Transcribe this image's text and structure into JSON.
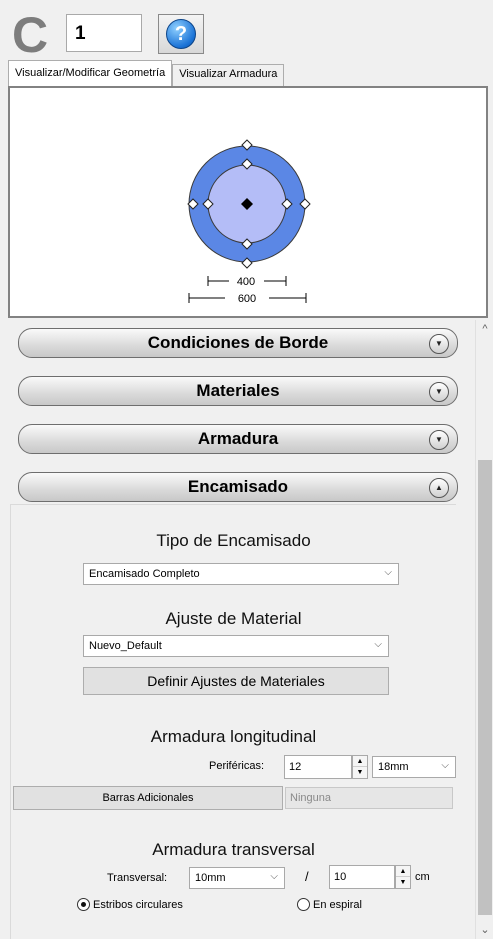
{
  "header": {
    "type_letter": "C",
    "element_id": "1",
    "help_icon": "question-icon"
  },
  "tabs": [
    {
      "label": "Visualizar/Modificar Geometría",
      "active": true
    },
    {
      "label": "Visualizar Armadura",
      "active": false
    }
  ],
  "geometry": {
    "inner_dim_label": "400",
    "outer_dim_label": "600",
    "outer_color": "#5b87e5",
    "inner_color": "#b4bdf7"
  },
  "sections": [
    {
      "label": "Condiciones de Borde",
      "state": "collapsed"
    },
    {
      "label": "Materiales",
      "state": "collapsed"
    },
    {
      "label": "Armadura",
      "state": "collapsed"
    },
    {
      "label": "Encamisado",
      "state": "expanded"
    }
  ],
  "encamisado": {
    "tipo_heading": "Tipo de Encamisado",
    "tipo_value": "Encamisado Completo",
    "ajuste_heading": "Ajuste de Material",
    "ajuste_value": "Nuevo_Default",
    "definir_button": "Definir Ajustes de Materiales",
    "long_heading": "Armadura longitudinal",
    "perifericas_label": "Periféricas:",
    "perifericas_value": "12",
    "perifericas_diam": "18mm",
    "barras_button": "Barras Adicionales",
    "barras_value": "Ninguna",
    "trans_heading": "Armadura transversal",
    "transversal_label": "Transversal:",
    "transversal_diam": "10mm",
    "slash": "/",
    "spacing_value": "10",
    "spacing_unit": "cm",
    "radio_circular": "Estribos circulares",
    "radio_spiral": "En espiral",
    "selected_radio": "circular"
  }
}
